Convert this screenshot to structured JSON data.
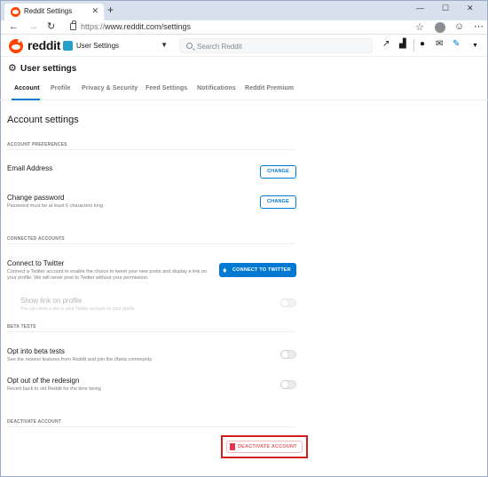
{
  "browser": {
    "tab_title": "Reddit Settings",
    "new_tab": "+",
    "close_tab": "✕",
    "url_prefix": "https://",
    "url": "www.reddit.com/settings",
    "window": {
      "minimize": "—",
      "maximize": "☐",
      "close": "✕"
    }
  },
  "header": {
    "logo_text": "reddit",
    "community": "User Settings",
    "search_placeholder": "Search Reddit"
  },
  "page": {
    "title": "User settings",
    "tabs": [
      "Account",
      "Profile",
      "Privacy & Security",
      "Feed Settings",
      "Notifications",
      "Reddit Premium"
    ]
  },
  "account": {
    "heading": "Account settings",
    "preferences": {
      "section": "ACCOUNT PREFERENCES",
      "email_title": "Email Address",
      "email_button": "CHANGE",
      "password_title": "Change password",
      "password_desc": "Password must be at least 6 characters long",
      "password_button": "CHANGE"
    },
    "connected": {
      "section": "CONNECTED ACCOUNTS",
      "twitter_title": "Connect to Twitter",
      "twitter_desc": "Connect a Twitter account to enable the choice to tweet your new posts and display a link on your profile. We will never post to Twitter without your permission.",
      "twitter_button": "CONNECT TO TWITTER",
      "show_link_title": "Show link on profile",
      "show_link_desc": "You can show a link to your Twitter account on your profile"
    },
    "beta": {
      "section": "BETA TESTS",
      "optin_title": "Opt into beta tests",
      "optin_desc": "See the newest features from Reddit and join the r/beta community",
      "optout_title": "Opt out of the redesign",
      "optout_desc": "Revert back to old Reddit for the time being"
    },
    "deactivate": {
      "section": "DEACTIVATE ACCOUNT",
      "button": "DEACTIVATE ACCOUNT"
    }
  },
  "colors": {
    "accent": "#0079d3",
    "brand": "#ff4500",
    "danger": "#d41e1e"
  }
}
